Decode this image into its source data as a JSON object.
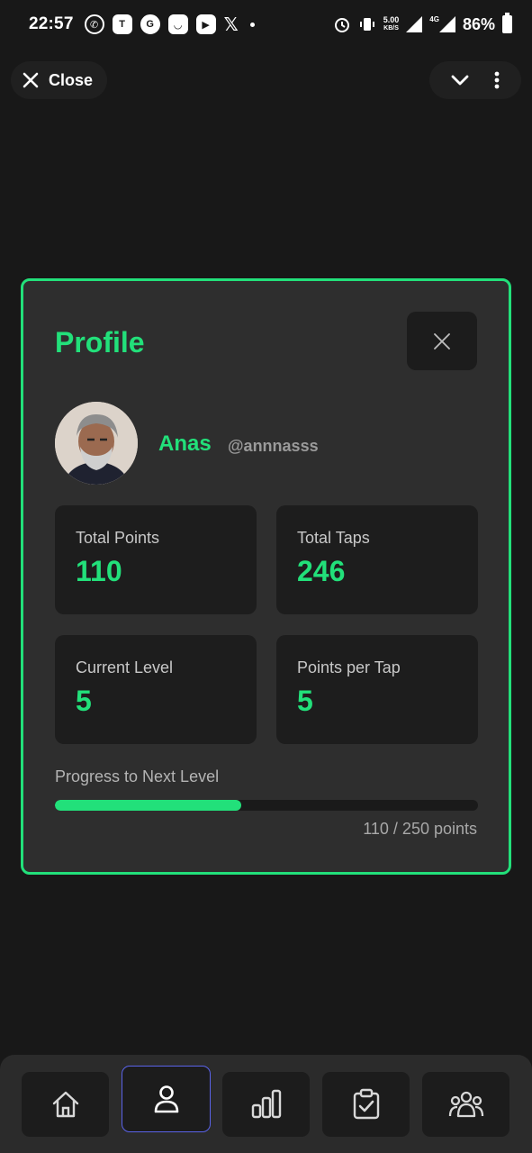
{
  "status_bar": {
    "time": "22:57",
    "net_speed_value": "5.00",
    "net_speed_unit": "KB/S",
    "network": "4G",
    "battery": "86%"
  },
  "top_bar": {
    "close_label": "Close"
  },
  "profile": {
    "title": "Profile",
    "name": "Anas",
    "handle": "@annnasss",
    "stats": [
      {
        "label": "Total Points",
        "value": "110"
      },
      {
        "label": "Total Taps",
        "value": "246"
      },
      {
        "label": "Current Level",
        "value": "5"
      },
      {
        "label": "Points per Tap",
        "value": "5"
      }
    ],
    "progress": {
      "label": "Progress to Next Level",
      "current": 110,
      "target": 250,
      "text": "110 / 250 points"
    }
  },
  "bottom_nav": {
    "items": [
      {
        "icon": "home-icon",
        "active": false
      },
      {
        "icon": "user-icon",
        "active": true
      },
      {
        "icon": "bar-chart-icon",
        "active": false
      },
      {
        "icon": "clipboard-check-icon",
        "active": false
      },
      {
        "icon": "group-icon",
        "active": false
      }
    ]
  },
  "colors": {
    "accent": "#22e07a",
    "active_nav_border": "#5a63e8",
    "background": "#181818",
    "card": "#2e2e2e"
  }
}
